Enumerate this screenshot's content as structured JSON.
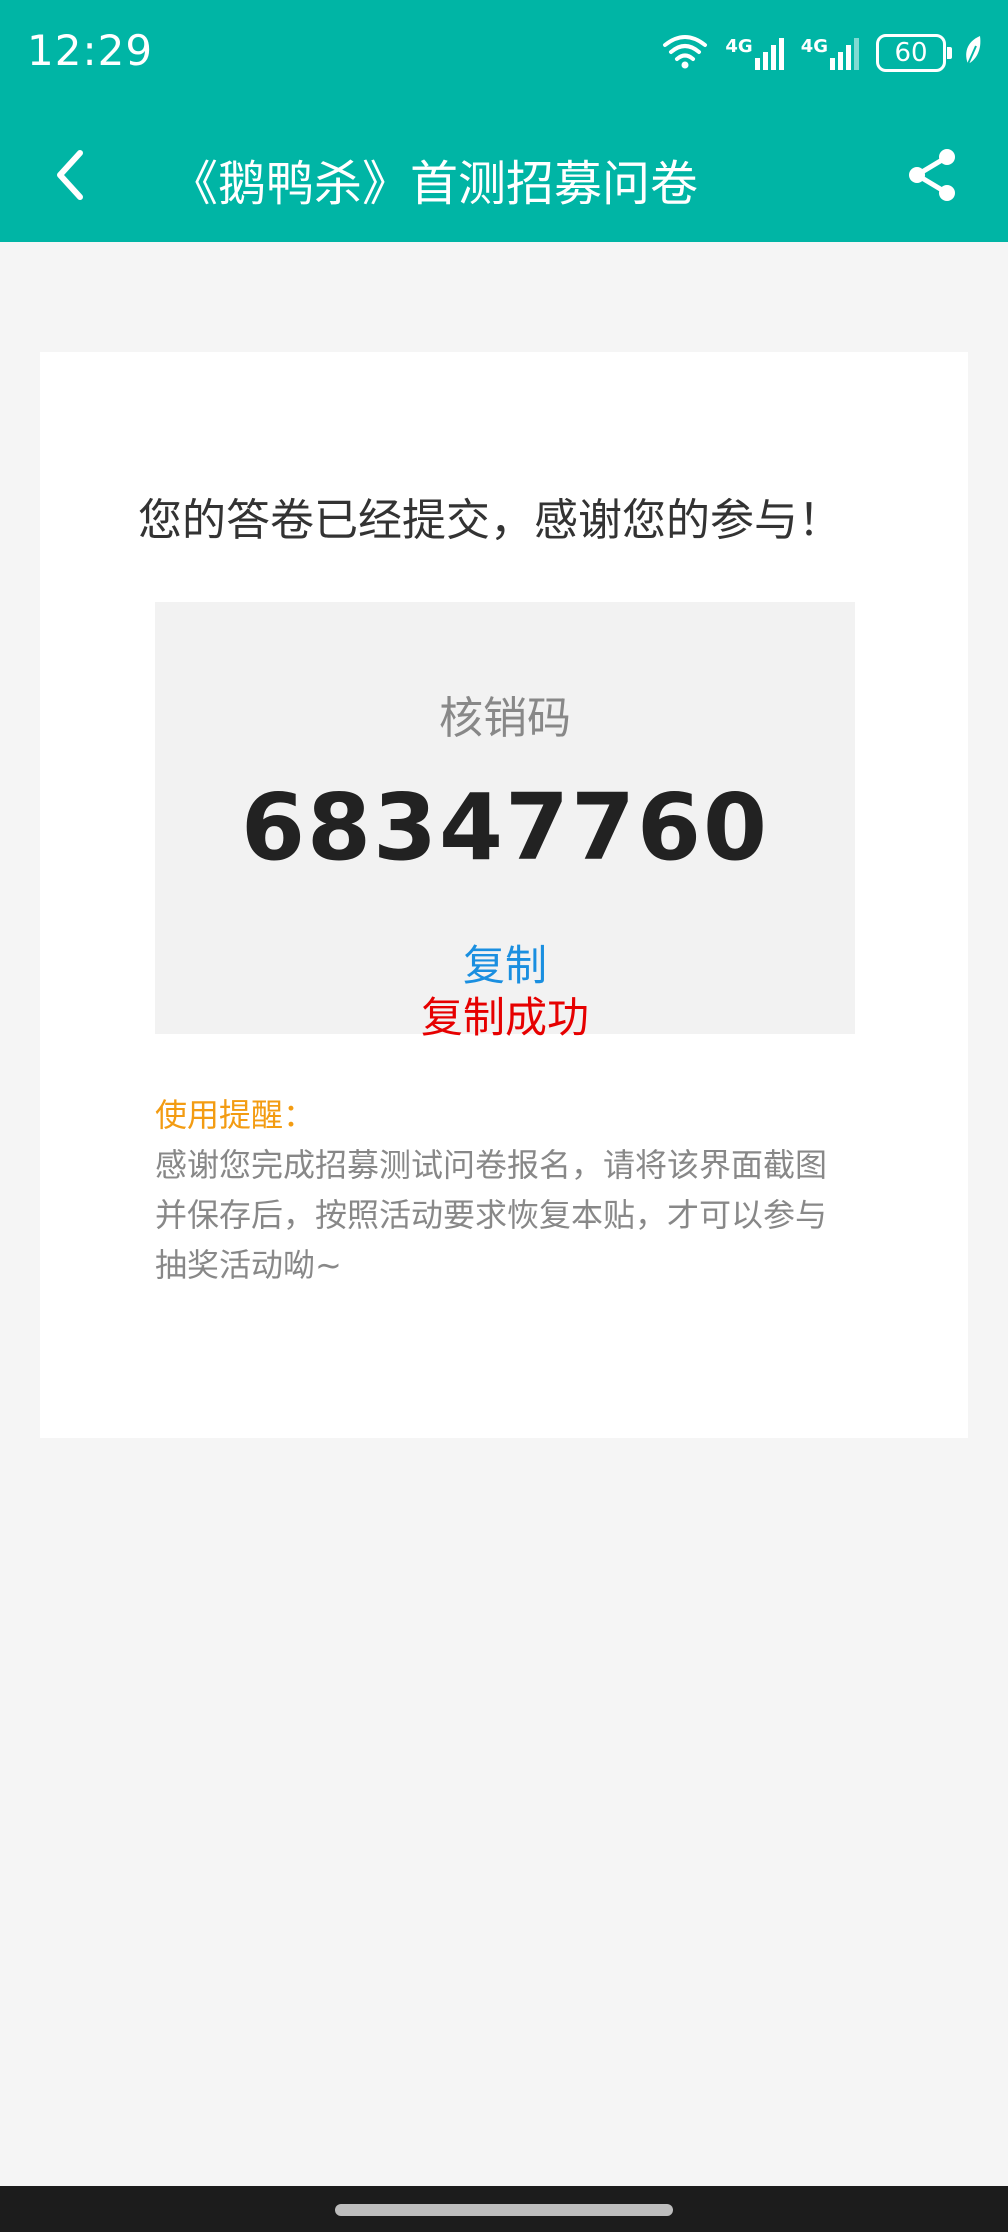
{
  "status": {
    "time": "12:29",
    "signal1": "4G",
    "signal2": "4G",
    "battery": "60"
  },
  "header": {
    "title": "《鹅鸭杀》首测招募问卷"
  },
  "result": {
    "thanks": "您的答卷已经提交，感谢您的参与！",
    "code_label": "核销码",
    "code_value": "68347760",
    "copy_label": "复制",
    "copy_success": "复制成功"
  },
  "reminder": {
    "title": "使用提醒：",
    "text": "感谢您完成招募测试问卷报名，请将该界面截图并保存后，按照活动要求恢复本贴，才可以参与抽奖活动呦~"
  },
  "colors": {
    "header_bg": "#00b5a5",
    "copy": "#1a8fe0",
    "success": "#e60000",
    "reminder_title": "#f39c12"
  }
}
